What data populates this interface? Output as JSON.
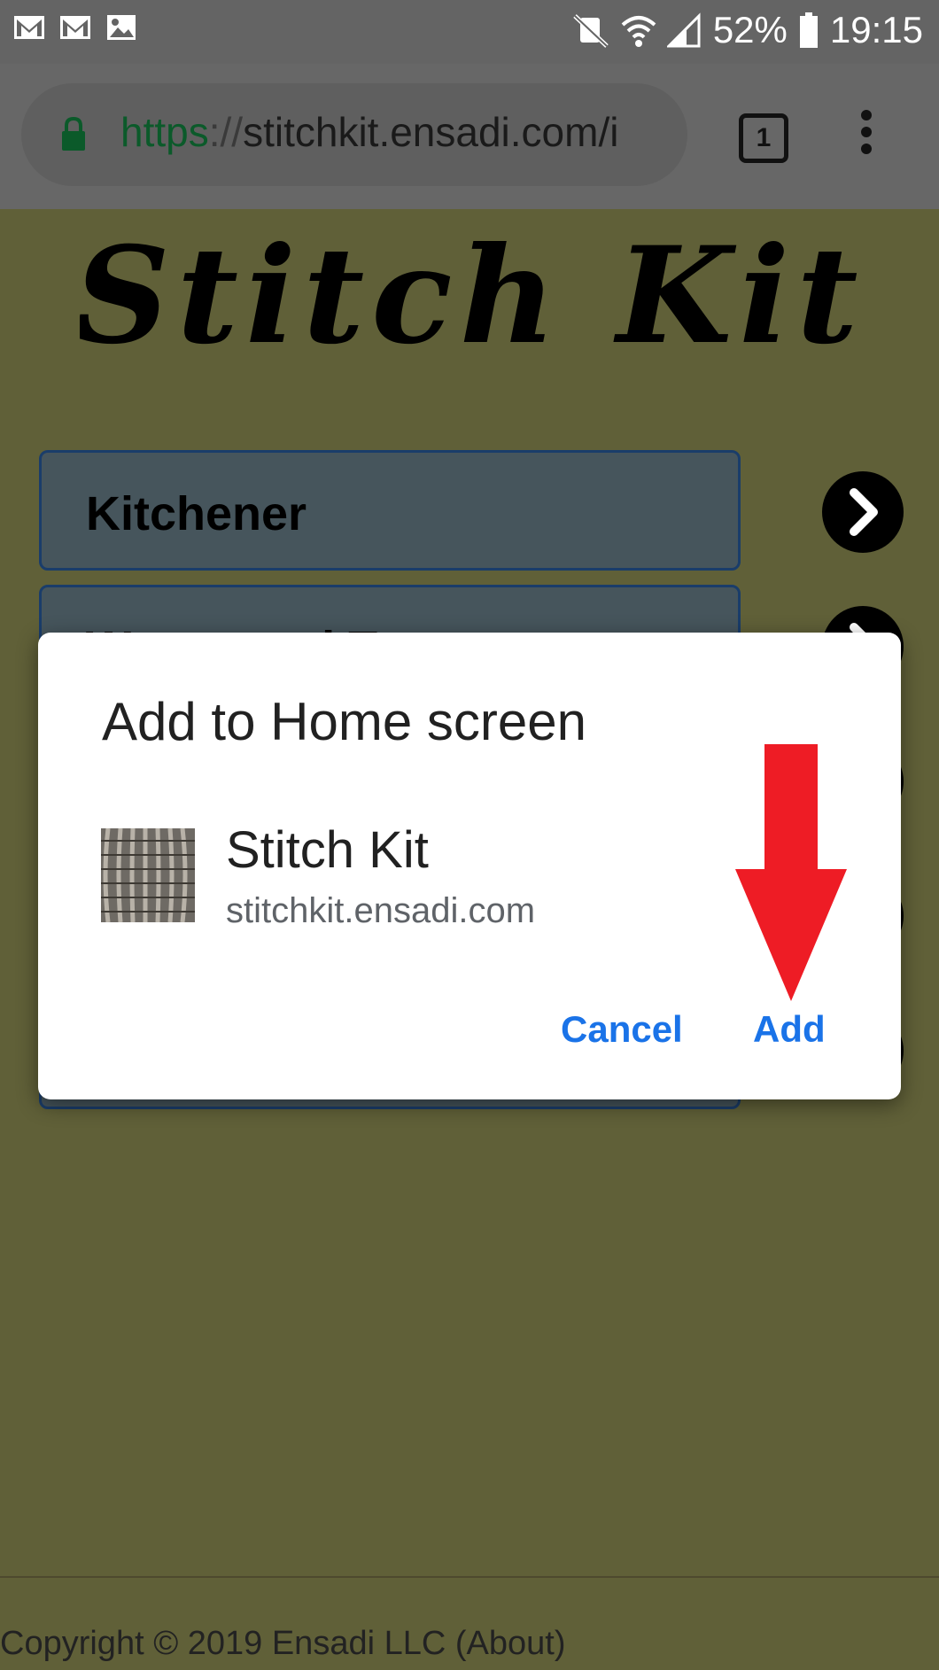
{
  "status_bar": {
    "battery": "52%",
    "time": "19:15",
    "left_icons": [
      "gmail-icon",
      "gmail-icon",
      "image-icon"
    ],
    "right_icons": [
      "mute-vibrate-icon",
      "wifi-icon",
      "signal-icon",
      "battery-icon"
    ]
  },
  "browser": {
    "url_scheme": "https",
    "url_sep": "://",
    "url_rest": "stitchkit.ensadi.com/i",
    "tab_count": "1"
  },
  "page": {
    "logo_text": "Stitch Kit",
    "menu_items": [
      {
        "label": "Kitchener"
      },
      {
        "label": "Weave and T..."
      }
    ],
    "footer_text": "Copyright © 2019 Ensadi LLC (",
    "footer_link": "About",
    "footer_end": ")"
  },
  "dialog": {
    "title": "Add to Home screen",
    "app_name": "Stitch Kit",
    "app_origin": "stitchkit.ensadi.com",
    "cancel_label": "Cancel",
    "add_label": "Add"
  },
  "colors": {
    "page_background": "#606038",
    "button_blue": "#1a73e8",
    "annotation_red": "#ee1c25"
  }
}
